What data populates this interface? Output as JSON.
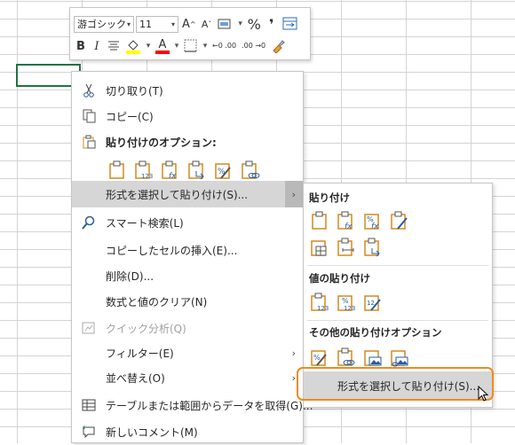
{
  "mini_toolbar": {
    "font_name": "游ゴシック",
    "font_size": "11",
    "grow_font": "A",
    "shrink_font": "A",
    "percent": "%",
    "comma": "❜",
    "bold": "B",
    "italic": "I",
    "fill_color": "#ffff00",
    "font_color": "#ff0000",
    "font_color_letter": "A",
    "increase_decimal": "←0 .00",
    "decrease_decimal": ".00 →0"
  },
  "context_menu": {
    "items": [
      {
        "label": "切り取り(T)",
        "icon": "scissors-icon"
      },
      {
        "label": "コピー(C)",
        "icon": "copy-icon"
      },
      {
        "label": "貼り付けのオプション:",
        "icon": "clipboard-icon"
      },
      {
        "label": "形式を選択して貼り付け(S)...",
        "submenu": "›"
      },
      {
        "label": "スマート検索(L)",
        "icon": "smart-lookup-icon"
      },
      {
        "label": "コピーしたセルの挿入(E)..."
      },
      {
        "label": "削除(D)..."
      },
      {
        "label": "数式と値のクリア(N)"
      },
      {
        "label": "クイック分析(Q)",
        "icon": "quick-analysis-icon"
      },
      {
        "label": "フィルター(E)",
        "submenu": "›"
      },
      {
        "label": "並べ替え(O)",
        "submenu": "›"
      },
      {
        "label": "テーブルまたは範囲からデータを取得(G)...",
        "icon": "table-icon"
      },
      {
        "label": "新しいコメント(M)",
        "icon": "new-comment-icon"
      }
    ]
  },
  "paste_submenu": {
    "section_paste": "貼り付け",
    "section_values": "値の貼り付け",
    "section_other": "その他の貼り付けオプション",
    "paste_special_button": "形式を選択して貼り付け(S)...",
    "accent_color": "#f08a1c"
  }
}
